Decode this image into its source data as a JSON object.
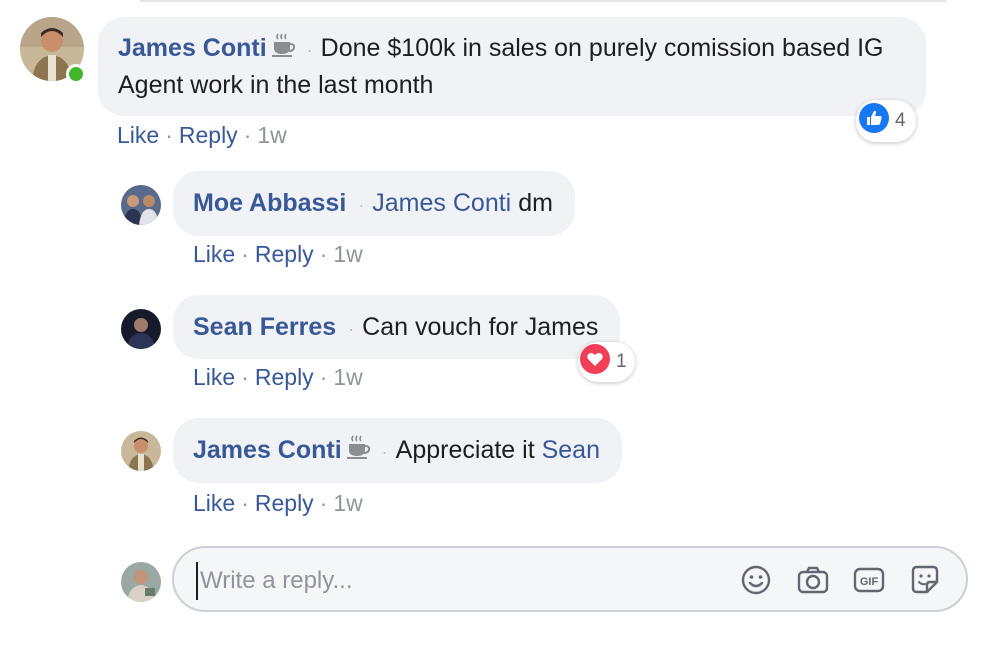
{
  "colors": {
    "link": "#385898",
    "bubble": "#f0f2f5",
    "online": "#42b72a",
    "like_blue": "#1877f2",
    "love_red": "#f33e58"
  },
  "comment": {
    "author": "James Conti",
    "author_badge_icon": "coffee-cup-icon",
    "text": "Done $100k in sales on purely comission based IG Agent work in the last month",
    "reaction_icon": "like-icon",
    "reaction_count": "4",
    "actions": {
      "like": "Like",
      "reply": "Reply",
      "time": "1w"
    },
    "online": true
  },
  "replies": [
    {
      "author": "Moe Abbassi",
      "mention": "James Conti",
      "text": "dm",
      "actions": {
        "like": "Like",
        "reply": "Reply",
        "time": "1w"
      }
    },
    {
      "author": "Sean Ferres",
      "text": "Can vouch for James",
      "reaction_icon": "love-icon",
      "reaction_count": "1",
      "actions": {
        "like": "Like",
        "reply": "Reply",
        "time": "1w"
      }
    },
    {
      "author": "James Conti",
      "author_badge_icon": "coffee-cup-icon",
      "text": "Appreciate it",
      "mention": "Sean",
      "actions": {
        "like": "Like",
        "reply": "Reply",
        "time": "1w"
      }
    }
  ],
  "reply_box": {
    "placeholder": "Write a reply...",
    "tools": [
      "emoji-icon",
      "camera-icon",
      "gif-icon",
      "sticker-icon"
    ]
  }
}
